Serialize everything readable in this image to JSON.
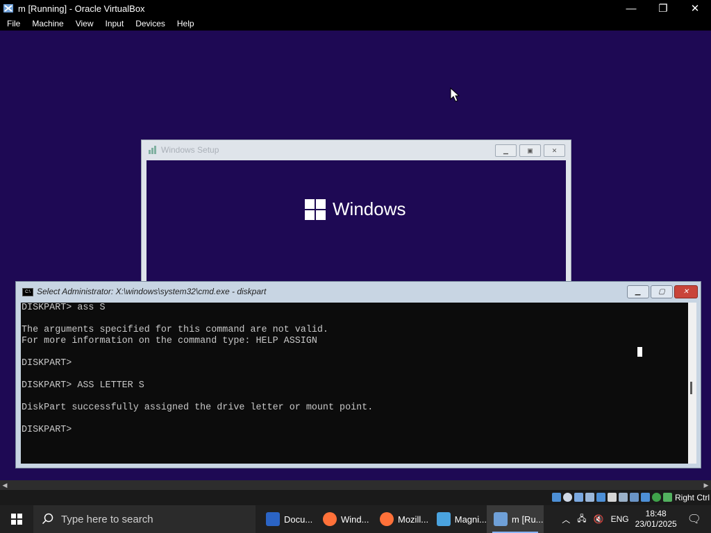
{
  "vbox": {
    "title": "m [Running] - Oracle VirtualBox",
    "controls": {
      "minimize": "—",
      "restore": "❐",
      "close": "✕"
    },
    "menu": [
      "File",
      "Machine",
      "View",
      "Input",
      "Devices",
      "Help"
    ],
    "host_key": "Right Ctrl"
  },
  "setup_window": {
    "title": "Windows Setup",
    "brand": "Windows"
  },
  "cmd": {
    "title": "Select Administrator: X:\\windows\\system32\\cmd.exe - diskpart",
    "lines": [
      "DISKPART> ass S",
      "",
      "The arguments specified for this command are not valid.",
      "For more information on the command type: HELP ASSIGN",
      "",
      "DISKPART>",
      "",
      "DISKPART> ASS LETTER S",
      "",
      "DiskPart successfully assigned the drive letter or mount point.",
      "",
      "DISKPART>"
    ]
  },
  "taskbar": {
    "search_placeholder": "Type here to search",
    "items": [
      {
        "label": "Docu...",
        "icon": "document-icon",
        "color": "#2b64c5"
      },
      {
        "label": "Wind...",
        "icon": "firefox-icon",
        "color": "#ff7139"
      },
      {
        "label": "Mozill...",
        "icon": "firefox-icon",
        "color": "#ff7139"
      },
      {
        "label": "Magni...",
        "icon": "magnifier-icon",
        "color": "#4aa3df"
      },
      {
        "label": "m [Ru...",
        "icon": "virtualbox-icon",
        "color": "#6fa0d8",
        "active": true
      }
    ],
    "language": "ENG",
    "time": "18:48",
    "date": "23/01/2025"
  }
}
